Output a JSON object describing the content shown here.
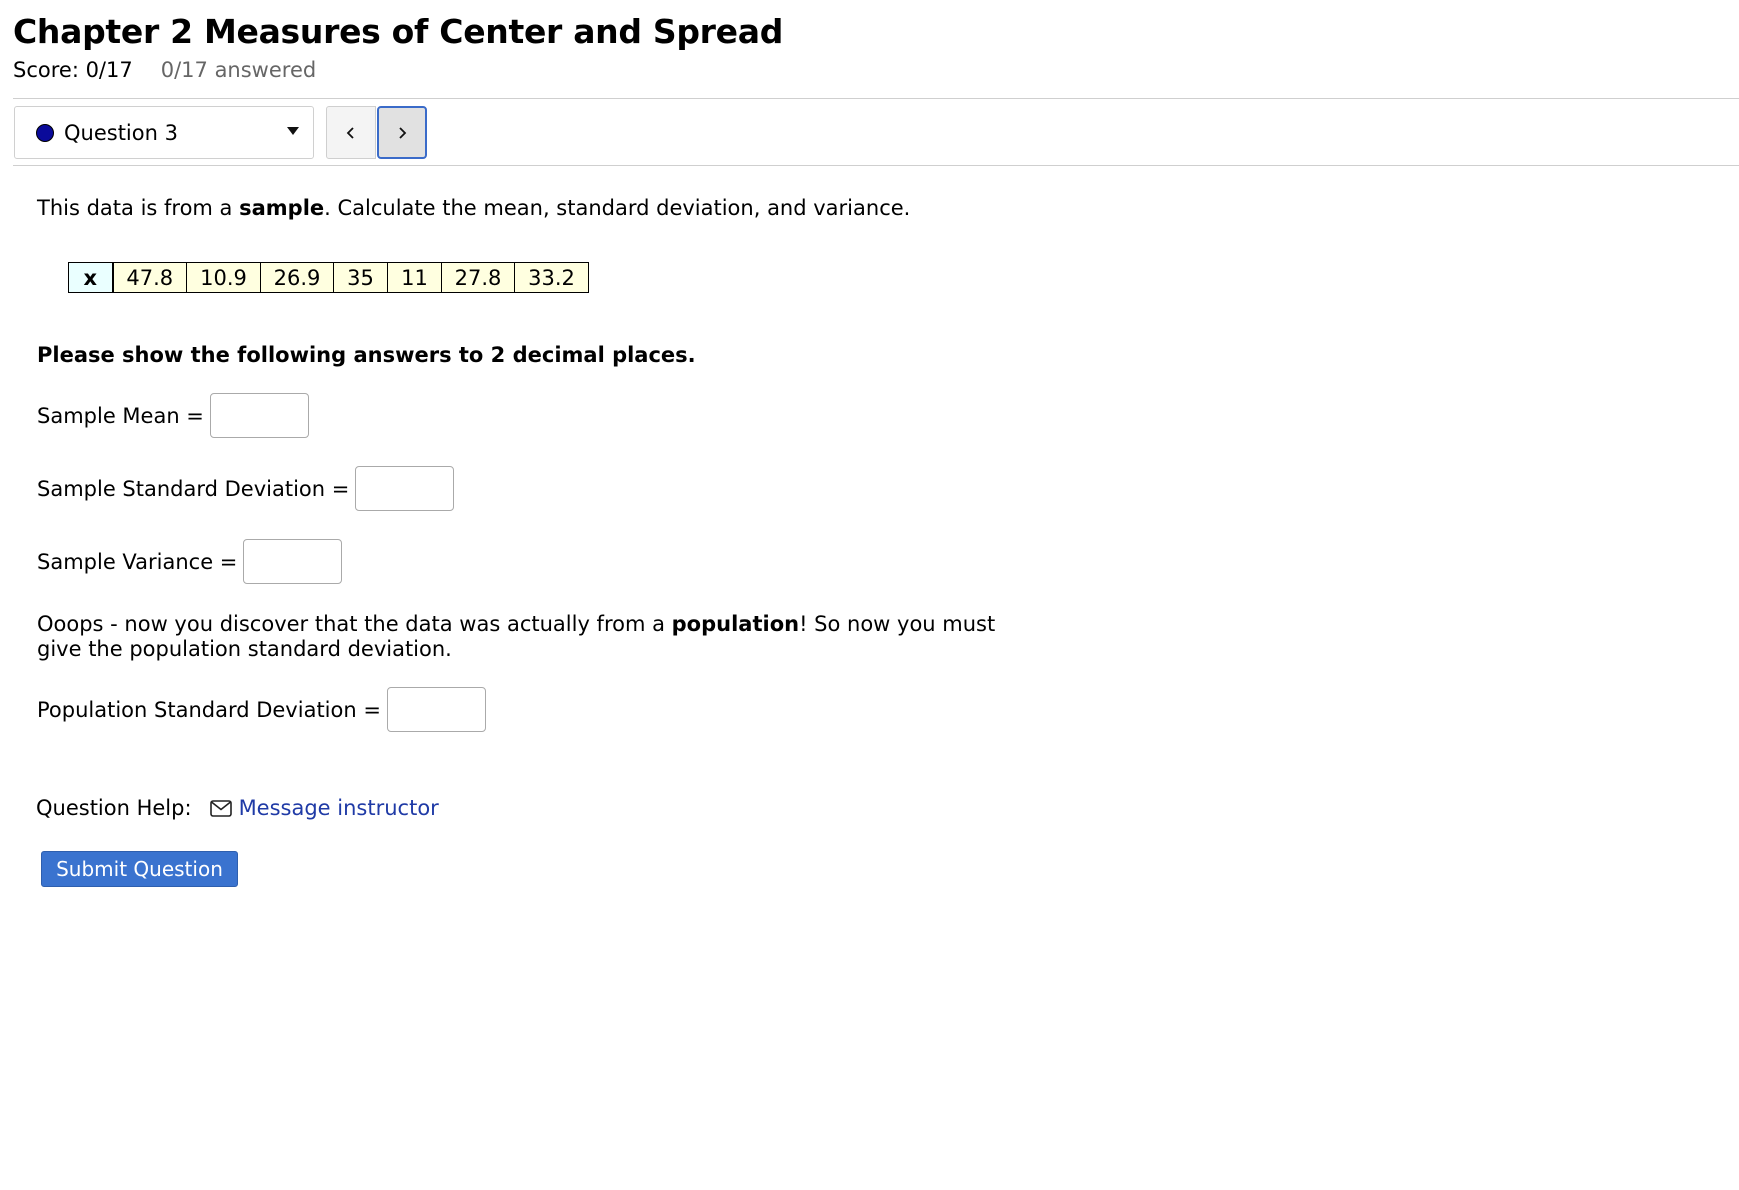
{
  "header": {
    "title": "Chapter 2 Measures of Center and Spread",
    "score": "Score: 0/17",
    "answered": "0/17 answered"
  },
  "nav": {
    "question_selector": "Question 3"
  },
  "question": {
    "intro_pre": "This data is from a ",
    "intro_bold": "sample",
    "intro_post": ". Calculate the mean, standard deviation, and variance.",
    "table_header": "x",
    "table_values": [
      "47.8",
      "10.9",
      "26.9",
      "35",
      "11",
      "27.8",
      "33.2"
    ],
    "instructions": "Please show the following answers to 2 decimal places.",
    "sample_mean_label": "Sample Mean =",
    "sample_sd_label": "Sample Standard Deviation =",
    "sample_var_label": "Sample Variance =",
    "oops_pre": "Ooops - now you discover that the data was actually from a ",
    "oops_bold": "population",
    "oops_post": "! So now you must give the population standard deviation.",
    "pop_sd_label": "Population Standard Deviation =",
    "sample_mean_value": "",
    "sample_sd_value": "",
    "sample_var_value": "",
    "pop_sd_value": ""
  },
  "help": {
    "label": "Question Help:",
    "message_link": "Message instructor"
  },
  "actions": {
    "submit_label": "Submit Question"
  },
  "colors": {
    "accent": "#3a73cf",
    "link": "#1f3aa6",
    "dot": "#0a0a9a",
    "table_cell_bg": "#ffffe0",
    "table_header_bg": "#eaffff"
  },
  "icons": {
    "question_status": "status-dot-icon",
    "dropdown": "caret-down-icon",
    "prev": "chevron-left-icon",
    "next": "chevron-right-icon",
    "message": "envelope-icon"
  }
}
